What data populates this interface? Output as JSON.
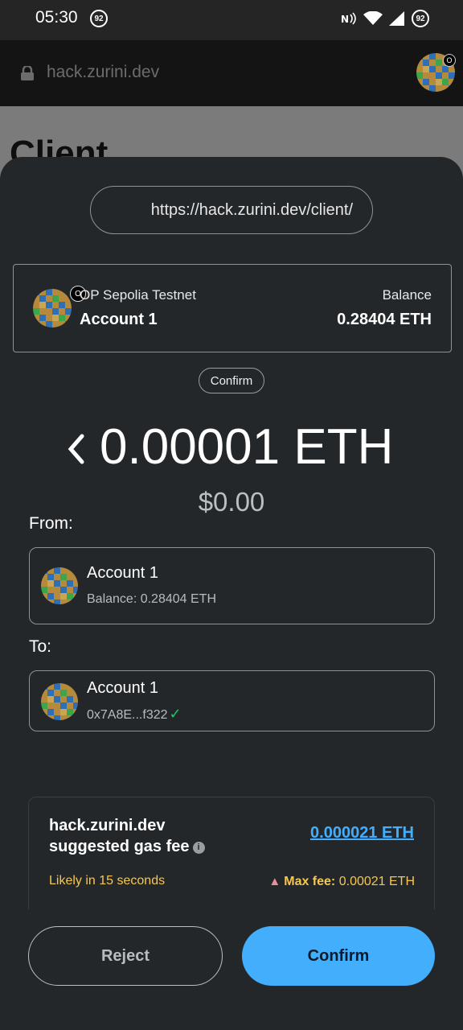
{
  "status_bar": {
    "time": "05:30",
    "badge": "92",
    "battery": "92"
  },
  "browser": {
    "url": "hack.zurini.dev"
  },
  "page": {
    "title": "Client"
  },
  "sheet": {
    "origin": "https://hack.zurini.dev/client/",
    "network": "OP Sepolia Testnet",
    "network_badge": "O",
    "account_name": "Account 1",
    "balance_label": "Balance",
    "balance_value": "0.28404 ETH",
    "chip_label": "Confirm",
    "amount": "0.00001 ETH",
    "fiat": "$0.00",
    "from_label": "From:",
    "from": {
      "name": "Account 1",
      "sub": "Balance: 0.28404 ETH"
    },
    "to_label": "To:",
    "to": {
      "name": "Account 1",
      "sub": "0x7A8E...f322"
    },
    "gas": {
      "title": "hack.zurini.dev suggested gas fee",
      "value": "0.000021 ETH",
      "likely": "Likely in  15 seconds",
      "max_fee_label": "Max fee:",
      "max_fee_value": "0.00021 ETH"
    },
    "buttons": {
      "reject": "Reject",
      "confirm": "Confirm"
    }
  },
  "colors": {
    "accent": "#43aefc",
    "warning": "#f7c74c",
    "success": "#27c46b",
    "sheet": "#24272a"
  },
  "icons": [
    "lock-icon",
    "chevron-left-icon",
    "info-icon",
    "warning-icon",
    "check-icon",
    "wifi-icon",
    "signal-icon",
    "nfc-icon"
  ]
}
